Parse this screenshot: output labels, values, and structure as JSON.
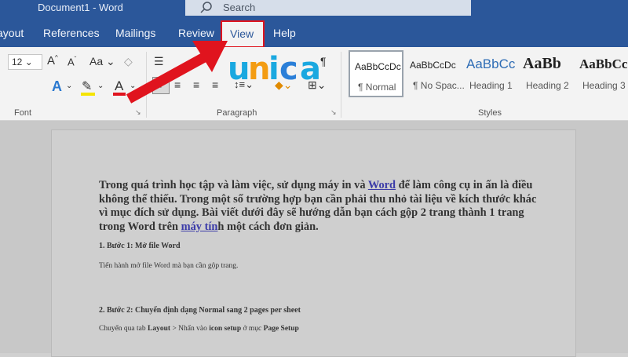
{
  "window": {
    "title": "Document1  -  Word"
  },
  "search": {
    "placeholder": "Search"
  },
  "tabs": [
    {
      "label": "ayout"
    },
    {
      "label": "References"
    },
    {
      "label": "Mailings"
    },
    {
      "label": "Review"
    },
    {
      "label": "View",
      "active": true,
      "highlight_color": "#e0141e"
    },
    {
      "label": "Help"
    }
  ],
  "ribbon": {
    "font_size": "12",
    "groups": {
      "font": "Font",
      "paragraph": "Paragraph",
      "styles": "Styles"
    },
    "styles": [
      {
        "sample": "AaBbCcDc",
        "name": "¶ Normal"
      },
      {
        "sample": "AaBbCcDc",
        "name": "¶ No Spac..."
      },
      {
        "sample": "AaBbCc",
        "name": "Heading 1"
      },
      {
        "sample": "AaBb",
        "name": "Heading 2"
      },
      {
        "sample": "AaBbCc",
        "name": "Heading 3"
      }
    ]
  },
  "logo": {
    "text": "unica",
    "colors": [
      "#1aa8e0",
      "#f39c12",
      "#1aa8e0",
      "#2b7fd8",
      "#1aa8e0"
    ]
  },
  "document": {
    "intro_parts": [
      "Trong quá trình học tập và làm việc, sử dụng máy in và ",
      "Word",
      " để làm công cụ in ấn là điều không thể thiếu. Trong một số trường hợp bạn cần phải thu nhỏ tài liệu về kích thước khác vì mục đích sử dụng. Bài viết dưới đây sẽ hướng dẫn bạn cách gộp 2 trang thành 1 trang trong Word trên ",
      "máy tín",
      "h một cách đơn giản."
    ],
    "step1_title": "1. Bước 1: Mở file Word",
    "step1_text": "Tiến hành mở file Word mà bạn cần gộp trang.",
    "step2_title": "2. Bước 2: Chuyển định dạng Normal sang 2 pages per sheet",
    "step2_text_parts": [
      "Chuyển qua tab ",
      "Layout",
      " > Nhấn vào ",
      "icon setup",
      " ở mục ",
      "Page Setup"
    ]
  },
  "colors": {
    "titlebar": "#2b579a",
    "arrow": "#e0141e",
    "link": "#3b3ba8"
  }
}
